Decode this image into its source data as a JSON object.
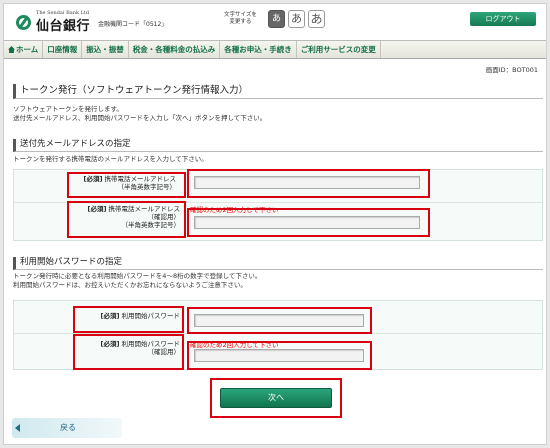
{
  "header": {
    "bank_name_en": "The Sendai Bank Ltd",
    "bank_name_jp": "仙台銀行",
    "bank_code": "金融機関コード「0512」",
    "font_size_label_1": "文字サイズを",
    "font_size_label_2": "変更する",
    "font_small": "あ",
    "font_medium": "あ",
    "font_large": "あ",
    "logout": "ログアウト",
    "brand_color": "#1f8a5e"
  },
  "nav": {
    "items": [
      {
        "label": "ホーム"
      },
      {
        "label": "口座情報"
      },
      {
        "label": "振込・振替"
      },
      {
        "label": "税金・各種料金の払込み"
      },
      {
        "label": "各種お申込・手続き"
      },
      {
        "label": "ご利用サービスの変更"
      }
    ]
  },
  "screen_id": "画面ID：BOT001",
  "page": {
    "title": "トークン発行（ソフトウェアトークン発行情報入力）",
    "desc_1": "ソフトウェアトークンを発行します。",
    "desc_2": "送付先メールアドレス、利用開始パスワードを入力し「次へ」ボタンを押して下さい。"
  },
  "email_section": {
    "title": "送付先メールアドレスの指定",
    "desc": "トークンを発行する携帯電話のメールアドレスを入力して下さい。",
    "required": "[必須]",
    "email_label": "携帯電話メールアドレス",
    "email_sub": "（半角英数字記号）",
    "confirm_label": "携帯電話メールアドレス",
    "confirm_sub1": "（確認用）",
    "confirm_sub2": "（半角英数字記号）",
    "confirm_note": "確認のため2回入力して下さい",
    "email_value": "",
    "confirm_value": ""
  },
  "password_section": {
    "title": "利用開始パスワードの指定",
    "desc_1": "トークン発行時に必要となる利用開始パスワードを4～8桁の数字で登録して下さい。",
    "desc_2": "利用開始パスワードは、お控えいただくかお忘れにならないようご注意下さい。",
    "required": "[必須]",
    "pw_label": "利用開始パスワード",
    "confirm_label": "利用開始パスワード",
    "confirm_sub": "（確認用）",
    "confirm_note": "確認のため2回入力して下さい",
    "pw_value": "",
    "confirm_value": ""
  },
  "buttons": {
    "next": "次へ",
    "back": "戻る"
  }
}
